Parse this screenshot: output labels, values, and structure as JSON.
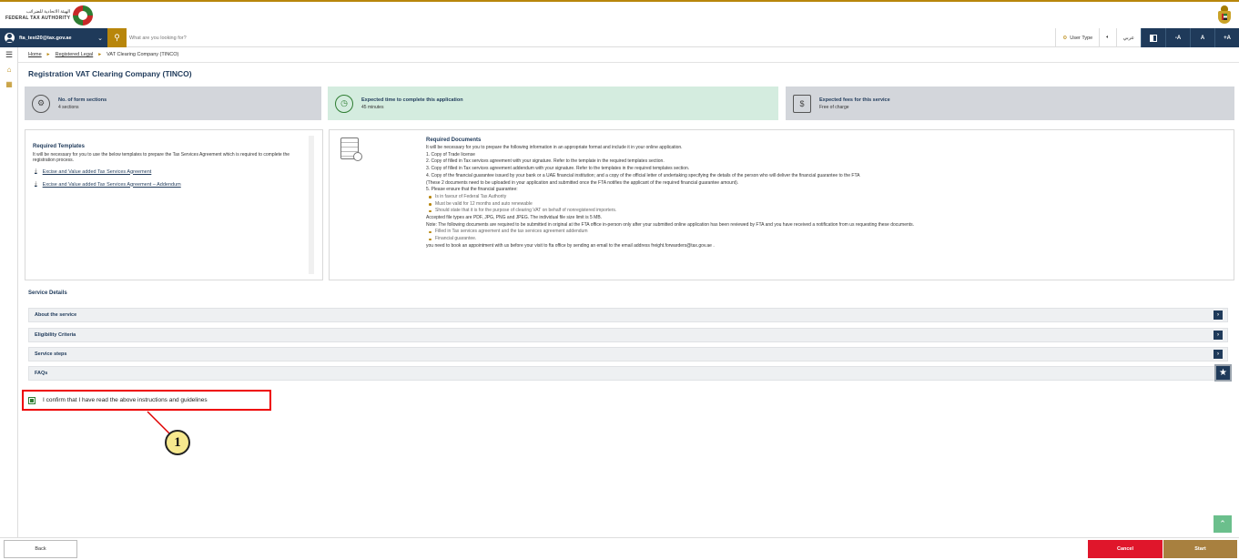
{
  "header": {
    "logo_ar": "الهيئة الاتحادية للضرائب",
    "logo_en": "FEDERAL TAX AUTHORITY",
    "emblem_icon": "uae-emblem-icon"
  },
  "navbar": {
    "user_email": "fta_test20@tax.gov.ae",
    "search_placeholder": "What are you looking for?",
    "user_type": "User Type",
    "language": "عربي",
    "font_decrease": "-A",
    "font_normal": "A",
    "font_increase": "+A"
  },
  "breadcrumb": {
    "home": "Home",
    "registered_legal": "Registered Legal",
    "current": "VAT Clearing Company (TINCO)"
  },
  "page": {
    "title": "Registration VAT Clearing Company (TINCO)"
  },
  "info_cards": {
    "sections": {
      "label": "No. of form sections",
      "value": "4 sections"
    },
    "time": {
      "label": "Expected time to complete this application",
      "value": "45 minutes"
    },
    "fees": {
      "label": "Expected fees for this service",
      "value": "Free of charge"
    }
  },
  "templates": {
    "heading": "Required Templates",
    "description": "It will be necessary for you to use the below templates to prepare the Tax Services Agreement which is required to complete the registration process.",
    "link1": "Excise and Value added Tax Services Agreement",
    "link2": "Excise and Value added Tax Services Agreement – Addendum"
  },
  "documents": {
    "heading": "Required Documents",
    "l0": "It will be necessary for you to prepare the following information in an appropriate format and include it in your online application.",
    "l1": "1. Copy of Trade license",
    "l2": "2. Copy of filled in Tax services agreement with your signature. Refer to the template in the required templates section.",
    "l3": "3. Copy of filled in Tax services agreement addendum with your signature. Refer to the templates in the required templates section.",
    "l4": "4. Copy of the financial guarantee issued by your bank or a UAE financial institution; and a copy of the official letter of undertaking specifying the details of the person who will deliver the financial guarantee to the FTA",
    "l5": "(These 2 documents need to be uploaded in your application and submitted once the FTA notifies the applicant of the required financial guarantee amount).",
    "l6": "5. Please ensure that the financial guarantee:",
    "b1": "Is in favour of Federal Tax Authority",
    "b2": "Must be valid for 12 months and auto renewable",
    "b3": "Should state that it is for the purpose of clearing VAT on behalf of nonregistered importers.",
    "l7": "Accepted file types are PDF, JPG, PNG and JPEG. The individual file size limit is 5 MB.",
    "l8": "Note: The following documents are required to be submitted in original at the FTA office in-person only after your submitted online application has been reviewed by FTA and you have received a notification from us requesting these documents.",
    "b4": "Filled in Tax services agreement and the tax services agreement addendum",
    "b5": "Financial guarantee.",
    "l9": "you need to book an appointment with us before your visit to fta office by sending an email to the email address freight.forwarders@tax.gov.ae ."
  },
  "service_details": {
    "title": "Service Details",
    "about": "About the service",
    "eligibility": "Eligibility Criteria",
    "steps": "Service steps",
    "faqs": "FAQs"
  },
  "confirm": {
    "label": "I confirm that I have read the above instructions and guidelines",
    "checked": true
  },
  "callout": {
    "number": "1",
    "color": "#e00000"
  },
  "footer": {
    "back": "Back",
    "cancel": "Cancel",
    "start": "Start"
  },
  "colors": {
    "navy": "#1f3a5a",
    "gold": "#b8860b",
    "cancel_red": "#e0162b",
    "start_gold": "#a8803f"
  }
}
